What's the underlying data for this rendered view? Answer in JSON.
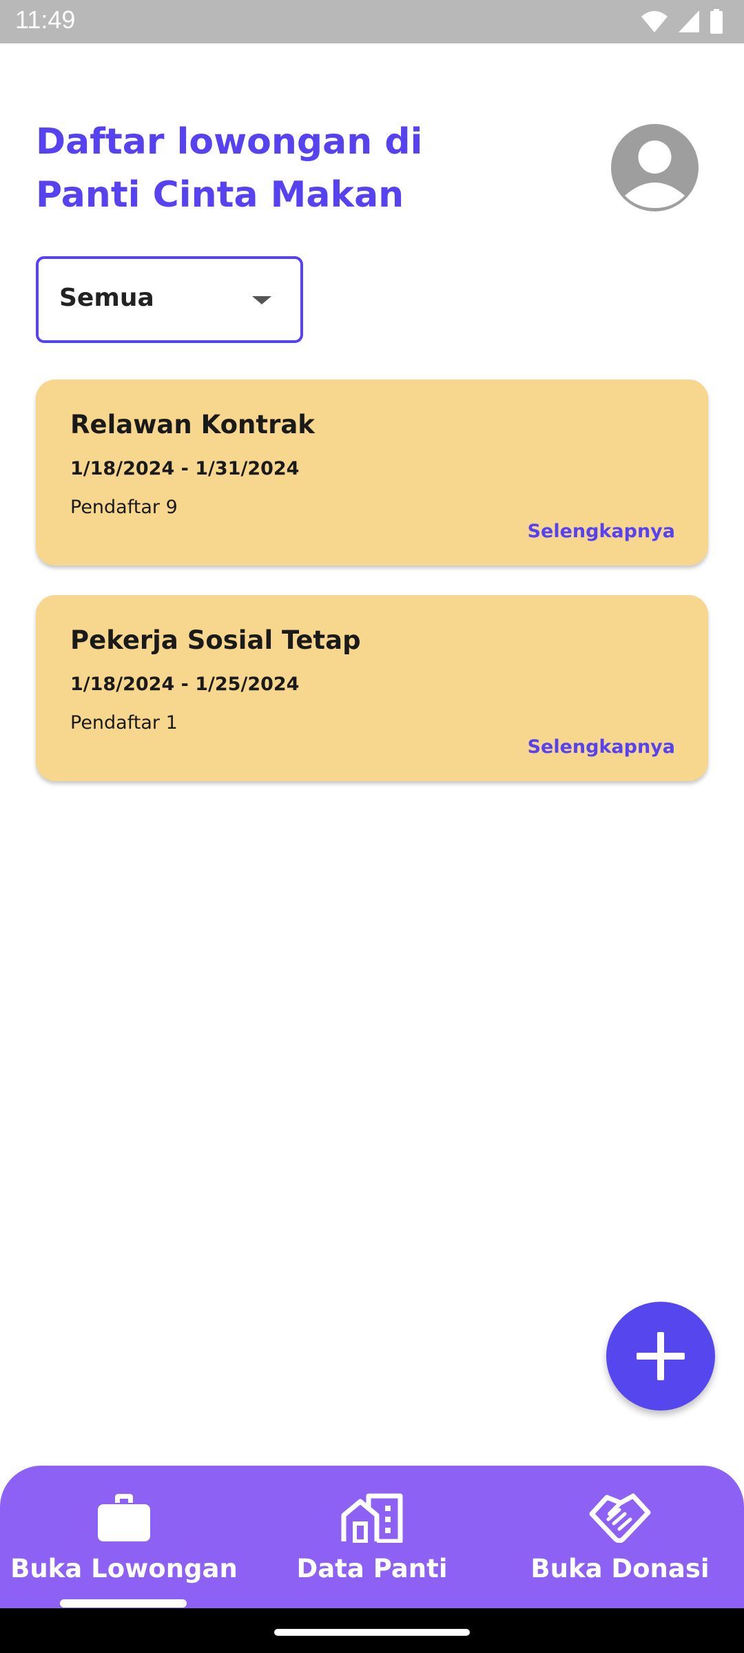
{
  "status_bar": {
    "time": "11:49",
    "icons": [
      "wifi-icon",
      "signal-icon",
      "battery-icon"
    ]
  },
  "header": {
    "title": "Daftar lowongan di Panti Cinta Makan",
    "avatar_icon": "account-circle-icon"
  },
  "filter": {
    "selected": "Semua"
  },
  "jobs": [
    {
      "title": "Relawan Kontrak",
      "dates": "1/18/2024 - 1/31/2024",
      "applicants": "Pendaftar 9",
      "more_label": "Selengkapnya"
    },
    {
      "title": "Pekerja Sosial Tetap",
      "dates": "1/18/2024 - 1/25/2024",
      "applicants": "Pendaftar 1",
      "more_label": "Selengkapnya"
    }
  ],
  "fab": {
    "icon": "plus-icon"
  },
  "bottom_nav": {
    "items": [
      {
        "label": "Buka Lowongan",
        "icon": "briefcase-icon",
        "active": true
      },
      {
        "label": "Data Panti",
        "icon": "building-icon",
        "active": false
      },
      {
        "label": "Buka Donasi",
        "icon": "handshake-icon",
        "active": false
      }
    ]
  },
  "colors": {
    "primary": "#5642f0",
    "card": "#f7d78e",
    "nav": "#8c61f3",
    "status_bar": "#b8b8b8"
  }
}
